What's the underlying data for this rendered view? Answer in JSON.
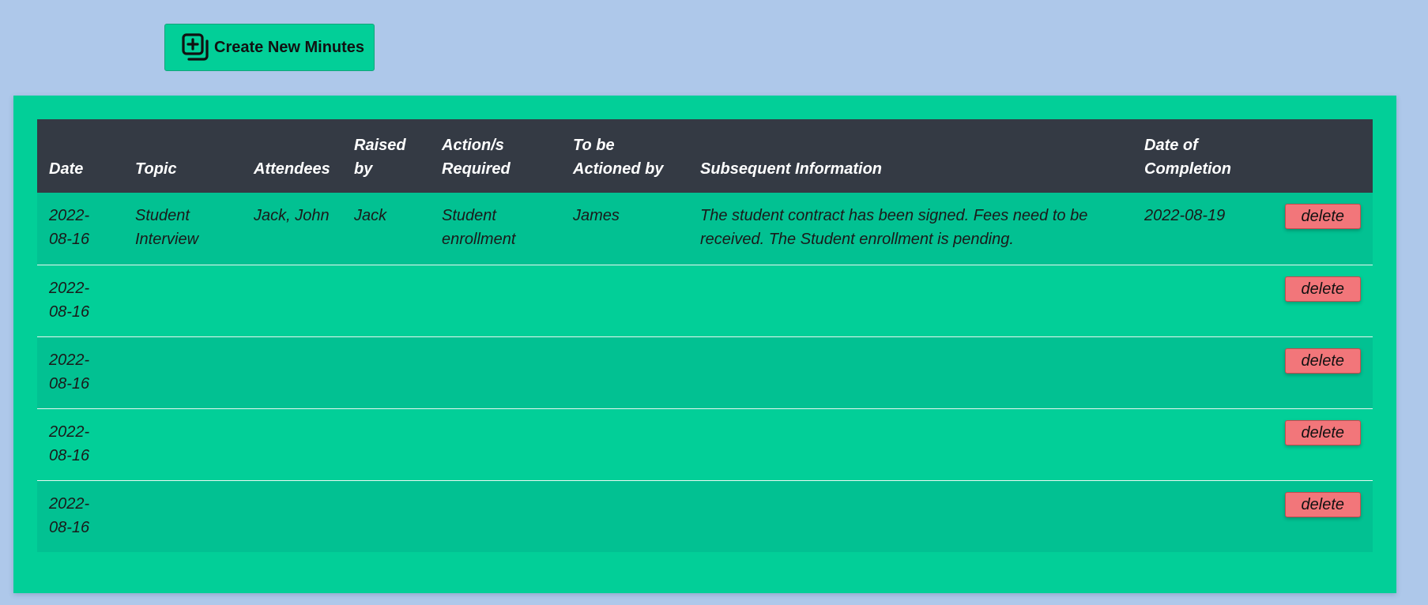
{
  "toolbar": {
    "create_label": "Create New Minutes",
    "create_icon": "add-copy-icon"
  },
  "table": {
    "headers": [
      "Date",
      "Topic",
      "Attendees",
      "Raised by",
      "Action/s Required",
      "To be Actioned by",
      "Subsequent Information",
      "Date of Completion",
      ""
    ],
    "rows": [
      {
        "date": "2022-08-16",
        "topic": "Student Interview",
        "attendees": "Jack, John",
        "raised_by": "Jack",
        "actions": "Student enrollment",
        "actioned_by": "James",
        "info": "The student contract has been signed. Fees need to be received. The Student enrollment is pending.",
        "completion": "2022-08-19",
        "delete_label": "delete"
      },
      {
        "date": "2022-08-16",
        "topic": "",
        "attendees": "",
        "raised_by": "",
        "actions": "",
        "actioned_by": "",
        "info": "",
        "completion": "",
        "delete_label": "delete"
      },
      {
        "date": "2022-08-16",
        "topic": "",
        "attendees": "",
        "raised_by": "",
        "actions": "",
        "actioned_by": "",
        "info": "",
        "completion": "",
        "delete_label": "delete"
      },
      {
        "date": "2022-08-16",
        "topic": "",
        "attendees": "",
        "raised_by": "",
        "actions": "",
        "actioned_by": "",
        "info": "",
        "completion": "",
        "delete_label": "delete"
      },
      {
        "date": "2022-08-16",
        "topic": "",
        "attendees": "",
        "raised_by": "",
        "actions": "",
        "actioned_by": "",
        "info": "",
        "completion": "",
        "delete_label": "delete"
      }
    ]
  },
  "colors": {
    "page_background": "#aec8ea",
    "panel": "#02cf98",
    "header": "#343a44",
    "delete_button": "#f2767a"
  }
}
